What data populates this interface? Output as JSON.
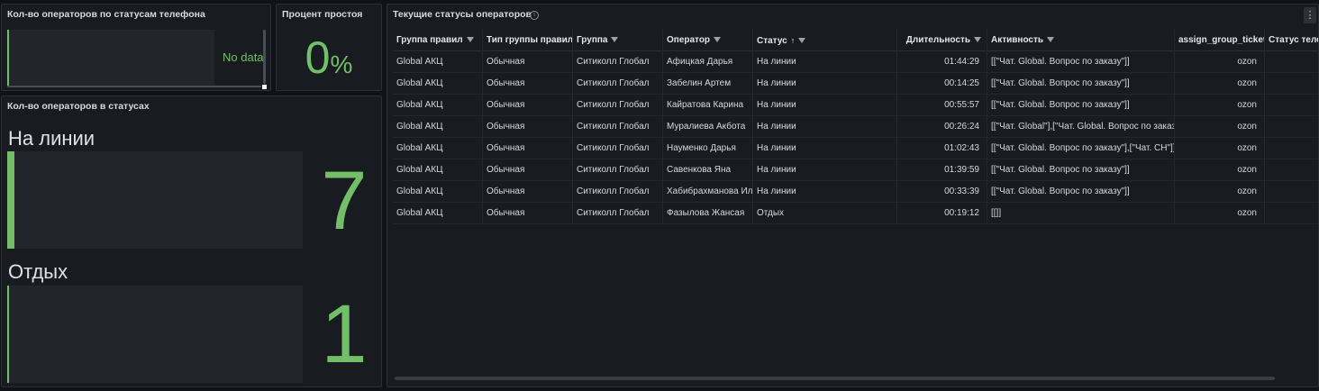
{
  "phone_panel": {
    "title": "Кол-во операторов по статусам телефона",
    "no_data": "No data"
  },
  "idle_panel": {
    "title": "Процент простоя",
    "value": "0",
    "unit": "%"
  },
  "status_panel": {
    "title": "Кол-во операторов в статусах",
    "items": [
      {
        "label": "На линии",
        "count": "7"
      },
      {
        "label": "Отдых",
        "count": "1"
      }
    ]
  },
  "table_panel": {
    "title": "Текущие статусы операторов",
    "info_icon": "i",
    "menu_icon": "⋮",
    "columns": [
      "Группа правил",
      "Тип группы правил",
      "Группа",
      "Оператор",
      "Статус",
      "Длительность",
      "Активность",
      "assign_group_ticket",
      "Статус телефона"
    ],
    "sort_arrow": "↑",
    "rows": [
      [
        "Global АКЦ",
        "Обычная",
        "Ситиколл Глобал",
        "Афицкая Дарья",
        "На линии",
        "01:44:29",
        "[[\"Чат. Global. Вопрос по заказу\"]]",
        "ozon",
        ""
      ],
      [
        "Global АКЦ",
        "Обычная",
        "Ситиколл Глобал",
        "Забелин Артем",
        "На линии",
        "00:14:25",
        "[[\"Чат. Global. Вопрос по заказу\"]]",
        "ozon",
        ""
      ],
      [
        "Global АКЦ",
        "Обычная",
        "Ситиколл Глобал",
        "Кайратова Карина",
        "На линии",
        "00:55:57",
        "[[\"Чат. Global. Вопрос по заказу\"]]",
        "ozon",
        ""
      ],
      [
        "Global АКЦ",
        "Обычная",
        "Ситиколл Глобал",
        "Муралиева Акбота",
        "На линии",
        "00:26:24",
        "[[\"Чат. Global\"],[\"Чат. Global. Вопрос по заказу\"]]",
        "ozon",
        ""
      ],
      [
        "Global АКЦ",
        "Обычная",
        "Ситиколл Глобал",
        "Науменко Дарья",
        "На линии",
        "01:02:43",
        "[[\"Чат. Global. Вопрос по заказу\"],[\"Чат. CH\"]]",
        "ozon",
        ""
      ],
      [
        "Global АКЦ",
        "Обычная",
        "Ситиколл Глобал",
        "Савенкова Яна",
        "На линии",
        "01:39:59",
        "[[\"Чат. Global. Вопрос по заказу\"]]",
        "ozon",
        ""
      ],
      [
        "Global АКЦ",
        "Обычная",
        "Ситиколл Глобал",
        "Хабибрахманова Ил",
        "На линии",
        "00:33:39",
        "[[\"Чат. Global. Вопрос по заказу\"]]",
        "ozon",
        ""
      ],
      [
        "Global АКЦ",
        "Обычная",
        "Ситиколл Глобал",
        "Фазылова Жансая",
        "Отдых",
        "00:19:12",
        "[[]]",
        "ozon",
        ""
      ]
    ]
  },
  "colors": {
    "accent_green": "#73bf69",
    "panel_bg": "#181b1f",
    "page_bg": "#111217"
  }
}
